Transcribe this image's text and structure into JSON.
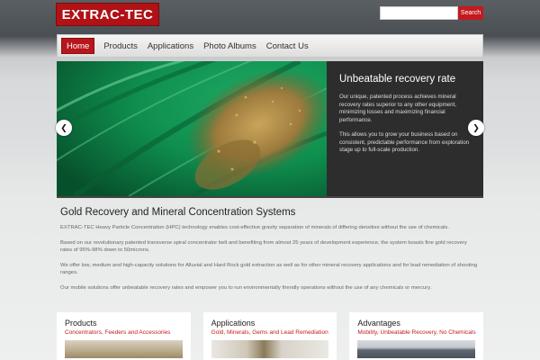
{
  "header": {
    "logo_text": "EXTRAC-TEC",
    "search_placeholder": "",
    "search_button": "Search"
  },
  "nav": {
    "items": [
      "Home",
      "Products",
      "Applications",
      "Photo Albums",
      "Contact Us"
    ],
    "active": "Home"
  },
  "slider": {
    "title": "Unbeatable recovery rate",
    "paragraph1": "Our unique, patented process achieves mineral recovery rates superior to any other equipment, minimizing losses and maximizing financial performance.",
    "paragraph2": "This allows you to grow your business based on consistent, predictable performance from exploration stage up to full-scale production.",
    "prev_icon": "chevron-left-icon",
    "next_icon": "chevron-right-icon"
  },
  "intro": {
    "title": "Gold Recovery and Mineral Concentration Systems",
    "p1": "EXTRAC-TEC Heavy Particle Concentration (HPC) technology enables cost-effective gravity separation of minerals of differing densities without the use of chemicals.",
    "p2": "Based on our revolutionary patented transverse spiral concentrator belt and benefiting from almost 25 years of development experience, the system boasts fine gold recovery rates of 95%-98% down to 50microns.",
    "p3": "We offer low, medium and high-capacity solutions for Alluvial and Hard Rock gold extraction as well as for other mineral recovery applications and for lead remediation of shooting ranges.",
    "p4": "Our mobile solutions offer unbeatable recovery rates and empower you to run environmentally friendly operations without the use of any chemicals or mercury."
  },
  "boxes": [
    {
      "title": "Products",
      "subtitle": "Concentrators, Feeders and Accessories"
    },
    {
      "title": "Applications",
      "subtitle": "Gold, Minerals, Gems and Lead Remediation"
    },
    {
      "title": "Advantages",
      "subtitle": "Mobility, Unbeatable Recovery, No Chemicals"
    }
  ],
  "colors": {
    "brand_red": "#b7161b",
    "header_dark": "#4a4f54"
  }
}
